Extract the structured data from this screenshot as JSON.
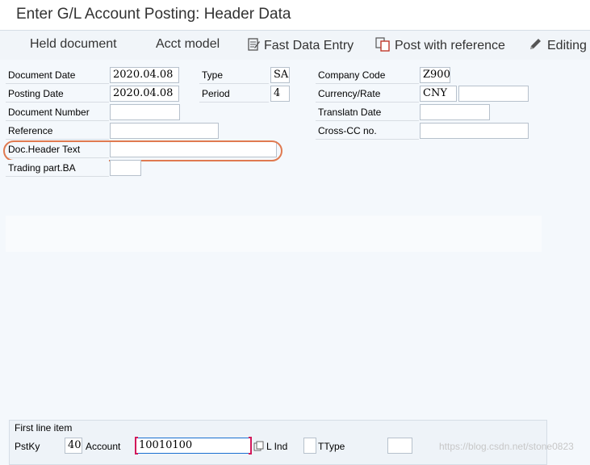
{
  "window": {
    "title": "Enter G/L Account Posting: Header Data"
  },
  "toolbar": {
    "held_document": "Held document",
    "acct_model": "Acct model",
    "fast_data_entry": "Fast Data Entry",
    "post_with_reference": "Post with reference",
    "editing": "Editing"
  },
  "header": {
    "document_date": {
      "label": "Document Date",
      "value": "2020.04.08"
    },
    "posting_date": {
      "label": "Posting Date",
      "value": "2020.04.08"
    },
    "document_number": {
      "label": "Document Number",
      "value": ""
    },
    "reference": {
      "label": "Reference",
      "value": ""
    },
    "doc_header_text": {
      "label": "Doc.Header Text",
      "value": ""
    },
    "trading_part_ba": {
      "label": "Trading part.BA",
      "value": ""
    },
    "type": {
      "label": "Type",
      "value": "SA"
    },
    "period": {
      "label": "Period",
      "value": "4"
    },
    "company_code": {
      "label": "Company Code",
      "value": "Z900"
    },
    "currency_rate": {
      "label": "Currency/Rate",
      "currency": "CNY",
      "rate": ""
    },
    "translatn_date": {
      "label": "Translatn Date",
      "value": ""
    },
    "cross_cc_no": {
      "label": "Cross-CC no.",
      "value": ""
    }
  },
  "first_line_item": {
    "title": "First line item",
    "pstky_label": "PstKy",
    "pstky_value": "40",
    "account_label": "Account",
    "account_value": "10010100",
    "sgl_ind_label": "L Ind",
    "sgl_ind_value": "",
    "ttype_label": "TType",
    "ttype_value": ""
  },
  "watermark": "https://blog.csdn.net/stone0823",
  "colors": {
    "highlight": "#e07a50",
    "caret": "#d2195a"
  }
}
